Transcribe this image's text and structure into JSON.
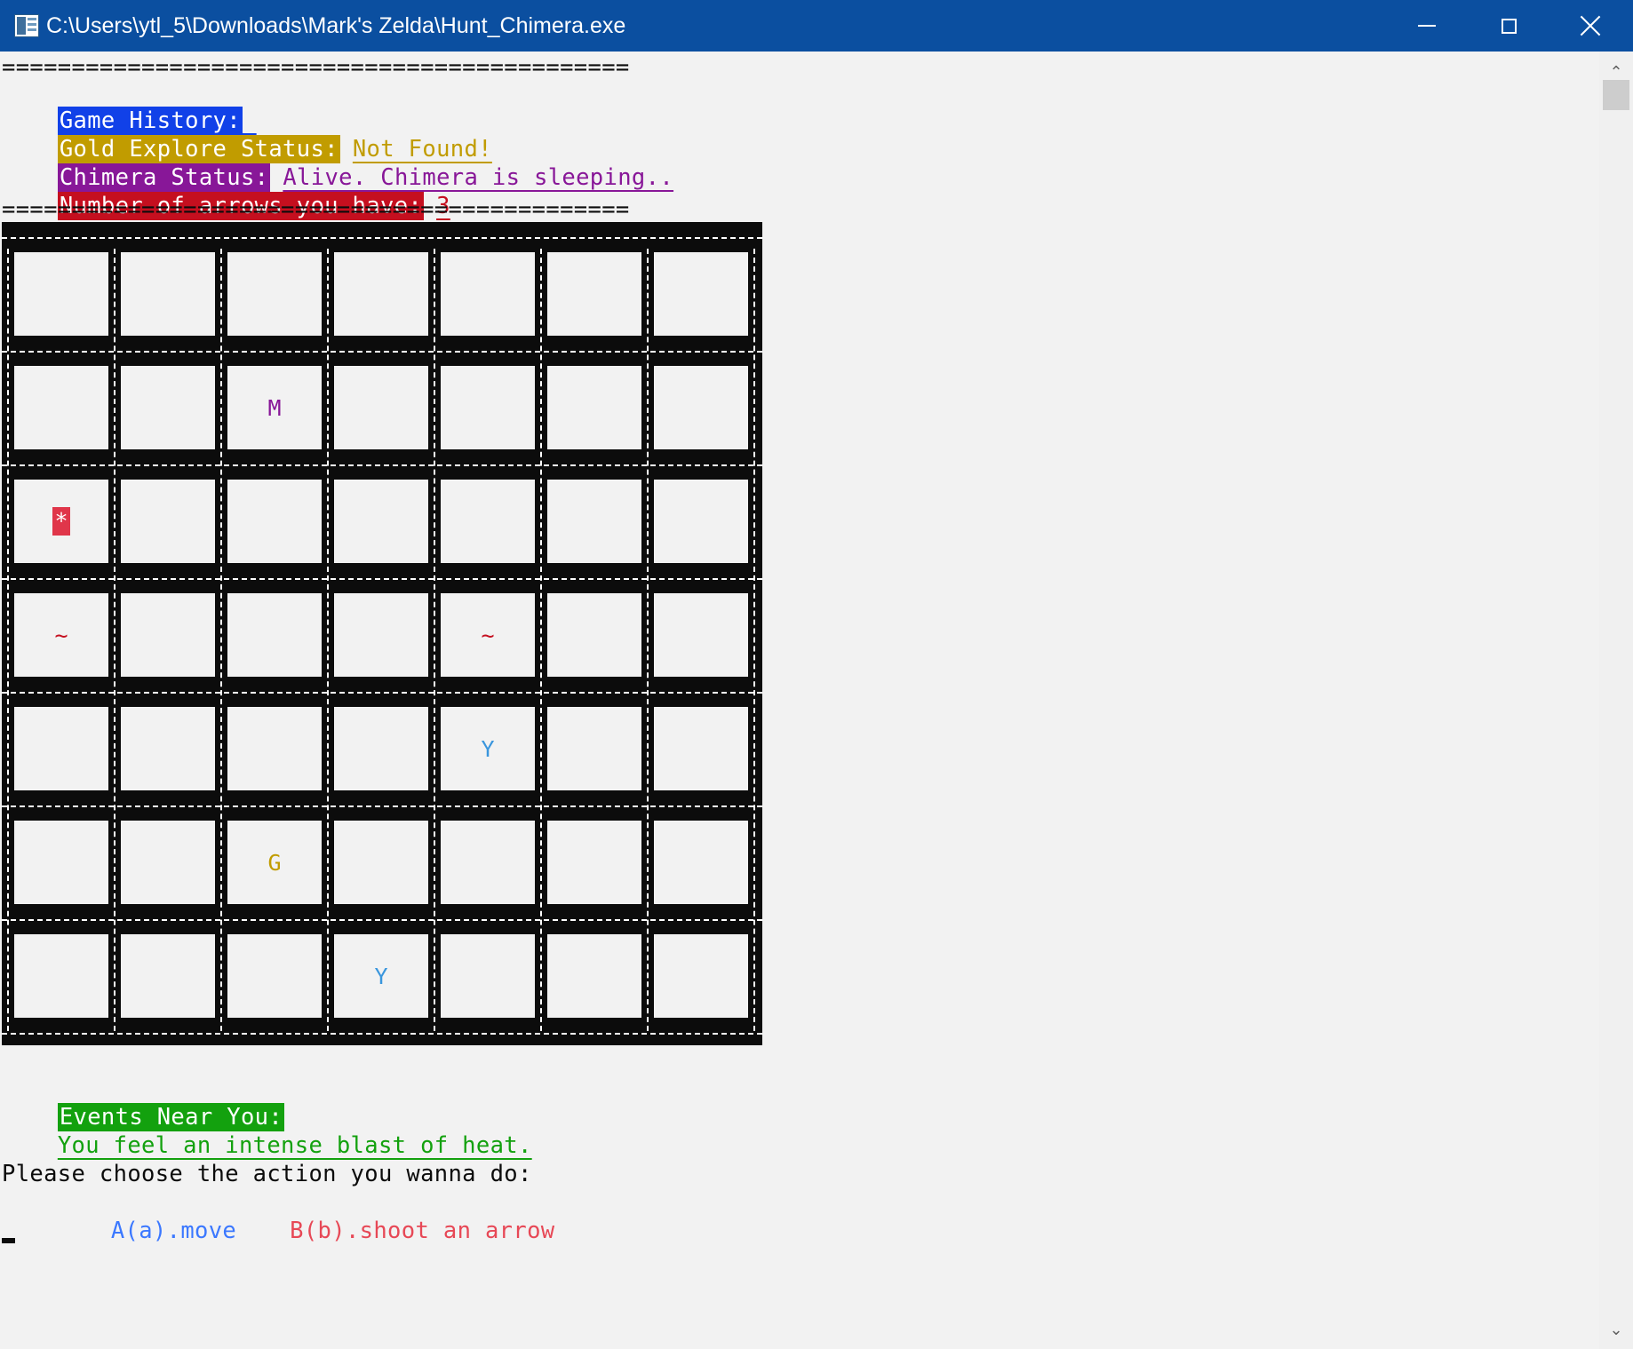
{
  "window": {
    "title": "C:\\Users\\ytl_5\\Downloads\\Mark's Zelda\\Hunt_Chimera.exe"
  },
  "colors": {
    "titlebar": "#0b4fa0",
    "history": "#1141e8",
    "gold": "#c19c00",
    "chimera": "#881798",
    "arrows": "#c50f1f",
    "events": "#13a10e",
    "move": "#3b78ff",
    "shoot": "#e74856"
  },
  "header": {
    "separator": "=============================================",
    "history_label": "Game History:",
    "gold_label": "Gold Explore Status:",
    "gold_value": "Not Found!",
    "chimera_label": "Chimera Status:",
    "chimera_value": "Alive. Chimera is sleeping..",
    "arrows_label": "Number of arrows you have:",
    "arrows_value": "3"
  },
  "map": {
    "rows": 7,
    "cols": 7,
    "cells": [
      [
        "",
        "",
        "",
        "",
        "",
        "",
        ""
      ],
      [
        "",
        "",
        "M",
        "",
        "",
        "",
        ""
      ],
      [
        "*",
        "",
        "",
        "",
        "",
        "",
        ""
      ],
      [
        "~",
        "",
        "",
        "",
        "~",
        "",
        ""
      ],
      [
        "",
        "",
        "",
        "",
        "Y",
        "",
        ""
      ],
      [
        "",
        "",
        "G",
        "",
        "",
        "",
        ""
      ],
      [
        "",
        "",
        "",
        "Y",
        "",
        "",
        ""
      ]
    ],
    "symbol_colors": {
      "M": "#881798",
      "*": "#ffffff",
      "~": "#c50f1f",
      "Y": "#3a96dd",
      "G": "#c19c00"
    }
  },
  "events": {
    "label": "Events Near You:",
    "message": "You feel an intense blast of heat."
  },
  "prompt": {
    "question": "Please choose the action you wanna do:",
    "option_a": "A(a).move",
    "option_b": "B(b).shoot an arrow"
  }
}
